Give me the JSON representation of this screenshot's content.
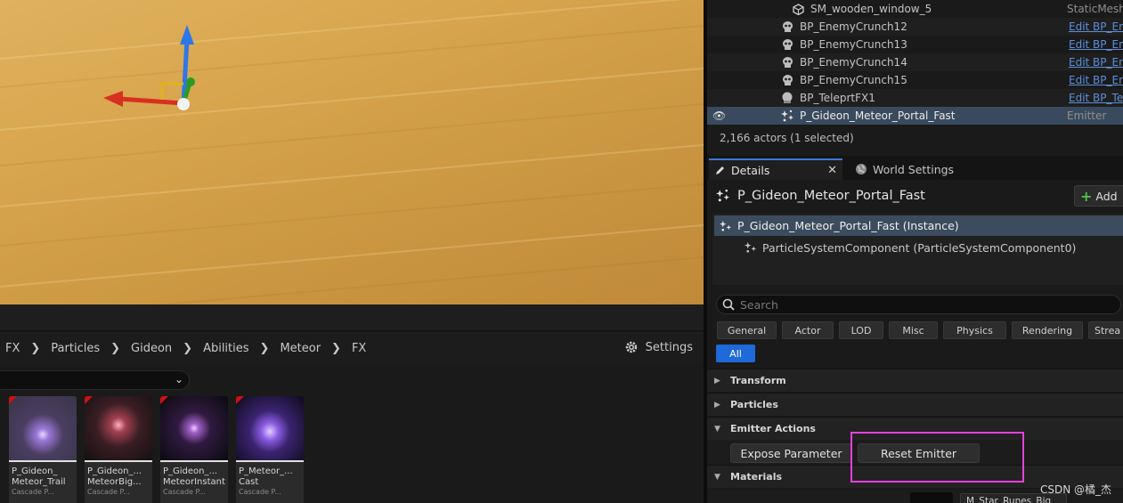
{
  "outliner": {
    "rows": [
      {
        "label": "SM_wooden_window_5",
        "type": "StaticMesh",
        "icon": "static-mesh-icon"
      },
      {
        "label": "BP_EnemyCrunch12",
        "link": "Edit BP_Ene",
        "icon": "skull-icon"
      },
      {
        "label": "BP_EnemyCrunch13",
        "link": "Edit BP_Ene",
        "icon": "skull-icon"
      },
      {
        "label": "BP_EnemyCrunch14",
        "link": "Edit BP_Ene",
        "icon": "skull-icon"
      },
      {
        "label": "BP_EnemyCrunch15",
        "link": "Edit BP_Ene",
        "icon": "skull-icon"
      },
      {
        "label": "BP_TeleprtFX1",
        "link": "Edit BP_Te",
        "icon": "actor-icon"
      },
      {
        "label": "P_Gideon_Meteor_Portal_Fast",
        "type": "Emitter",
        "icon": "emitter-icon",
        "selected": true
      }
    ],
    "actor_count": "2,166 actors (1 selected)"
  },
  "details": {
    "tab_details": "Details",
    "tab_world": "World Settings",
    "object_name": "P_Gideon_Meteor_Portal_Fast",
    "add_button": "Add",
    "components": {
      "instance": "P_Gideon_Meteor_Portal_Fast (Instance)",
      "psc": "ParticleSystemComponent (ParticleSystemComponent0)"
    },
    "search_placeholder": "Search",
    "categories": [
      "General",
      "Actor",
      "LOD",
      "Misc",
      "Physics",
      "Rendering",
      "Strea"
    ],
    "category_all": "All",
    "sections": {
      "transform": "Transform",
      "particles": "Particles",
      "emitter_actions": "Emitter Actions",
      "materials": "Materials"
    },
    "expose_parameter": "Expose Parameter",
    "reset_emitter": "Reset Emitter",
    "material_value": "M_Star_Runes_Big"
  },
  "content_browser": {
    "breadcrumb": [
      "FX",
      "Particles",
      "Gideon",
      "Abilities",
      "Meteor",
      "FX"
    ],
    "settings_label": "Settings",
    "assets": [
      {
        "name": "P_Gideon_\nMeteor_Trail",
        "type": "Cascade P..."
      },
      {
        "name": "P_Gideon_...\nMeteorBig...",
        "type": "Cascade P..."
      },
      {
        "name": "P_Gideon_...\nMeteorInstant",
        "type": "Cascade P..."
      },
      {
        "name": "P_Meteor_...\nCast",
        "type": "Cascade P..."
      }
    ]
  },
  "watermark": "CSDN @橘_杰"
}
